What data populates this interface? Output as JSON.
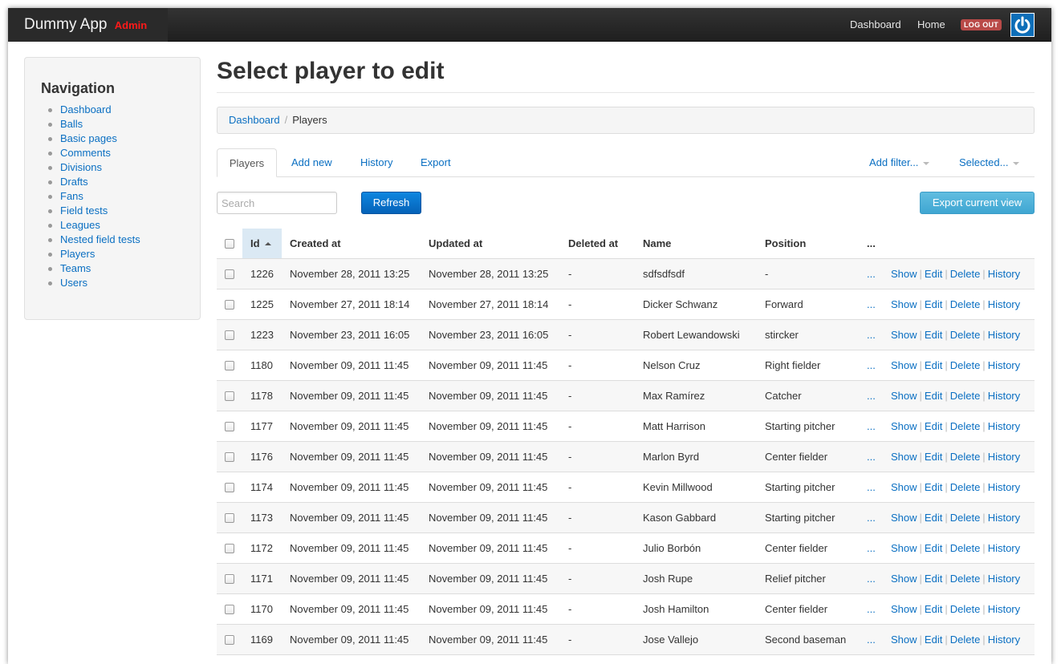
{
  "app": {
    "name": "Dummy App",
    "badge": "Admin"
  },
  "topnav": {
    "dashboard": "Dashboard",
    "home": "Home",
    "logout": "LOG OUT"
  },
  "sidebar": {
    "title": "Navigation",
    "items": [
      "Dashboard",
      "Balls",
      "Basic pages",
      "Comments",
      "Divisions",
      "Drafts",
      "Fans",
      "Field tests",
      "Leagues",
      "Nested field tests",
      "Players",
      "Teams",
      "Users"
    ]
  },
  "page": {
    "title": "Select player to edit"
  },
  "breadcrumb": {
    "root": "Dashboard",
    "separator": "/",
    "current": "Players"
  },
  "tabs": {
    "players": "Players",
    "add_new": "Add new",
    "history": "History",
    "export": "Export",
    "add_filter": "Add filter...",
    "selected": "Selected..."
  },
  "toolbar": {
    "search_placeholder": "Search",
    "refresh": "Refresh",
    "export_view": "Export current view"
  },
  "table": {
    "headers": {
      "id": "Id",
      "created": "Created at",
      "updated": "Updated at",
      "deleted": "Deleted at",
      "name": "Name",
      "position": "Position",
      "more": "..."
    },
    "action_labels": {
      "more": "...",
      "show": "Show",
      "edit": "Edit",
      "delete": "Delete",
      "history": "History"
    },
    "rows": [
      {
        "id": "1226",
        "created": "November 28, 2011 13:25",
        "updated": "November 28, 2011 13:25",
        "deleted": "-",
        "name": "sdfsdfsdf",
        "position": "-"
      },
      {
        "id": "1225",
        "created": "November 27, 2011 18:14",
        "updated": "November 27, 2011 18:14",
        "deleted": "-",
        "name": "Dicker Schwanz",
        "position": "Forward"
      },
      {
        "id": "1223",
        "created": "November 23, 2011 16:05",
        "updated": "November 23, 2011 16:05",
        "deleted": "-",
        "name": "Robert Lewandowski",
        "position": "stircker"
      },
      {
        "id": "1180",
        "created": "November 09, 2011 11:45",
        "updated": "November 09, 2011 11:45",
        "deleted": "-",
        "name": "Nelson Cruz",
        "position": "Right fielder"
      },
      {
        "id": "1178",
        "created": "November 09, 2011 11:45",
        "updated": "November 09, 2011 11:45",
        "deleted": "-",
        "name": "Max Ramírez",
        "position": "Catcher"
      },
      {
        "id": "1177",
        "created": "November 09, 2011 11:45",
        "updated": "November 09, 2011 11:45",
        "deleted": "-",
        "name": "Matt Harrison",
        "position": "Starting pitcher"
      },
      {
        "id": "1176",
        "created": "November 09, 2011 11:45",
        "updated": "November 09, 2011 11:45",
        "deleted": "-",
        "name": "Marlon Byrd",
        "position": "Center fielder"
      },
      {
        "id": "1174",
        "created": "November 09, 2011 11:45",
        "updated": "November 09, 2011 11:45",
        "deleted": "-",
        "name": "Kevin Millwood",
        "position": "Starting pitcher"
      },
      {
        "id": "1173",
        "created": "November 09, 2011 11:45",
        "updated": "November 09, 2011 11:45",
        "deleted": "-",
        "name": "Kason Gabbard",
        "position": "Starting pitcher"
      },
      {
        "id": "1172",
        "created": "November 09, 2011 11:45",
        "updated": "November 09, 2011 11:45",
        "deleted": "-",
        "name": "Julio Borbón",
        "position": "Center fielder"
      },
      {
        "id": "1171",
        "created": "November 09, 2011 11:45",
        "updated": "November 09, 2011 11:45",
        "deleted": "-",
        "name": "Josh Rupe",
        "position": "Relief pitcher"
      },
      {
        "id": "1170",
        "created": "November 09, 2011 11:45",
        "updated": "November 09, 2011 11:45",
        "deleted": "-",
        "name": "Josh Hamilton",
        "position": "Center fielder"
      },
      {
        "id": "1169",
        "created": "November 09, 2011 11:45",
        "updated": "November 09, 2011 11:45",
        "deleted": "-",
        "name": "Jose Vallejo",
        "position": "Second baseman"
      }
    ]
  },
  "colors": {
    "link": "#0a6fc2",
    "topbar": "#222222",
    "admin_badge": "#ff1a1a",
    "logout_badge": "#b94a48",
    "refresh_button": "#0562b8",
    "export_button": "#4fb1da"
  }
}
